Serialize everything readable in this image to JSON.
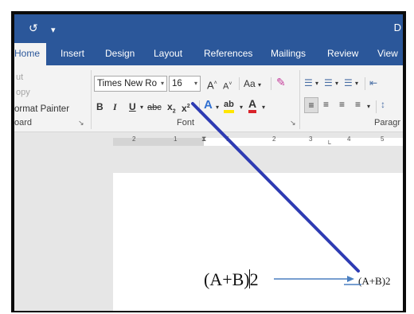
{
  "quick_access": {
    "undo_icon": "undo-icon",
    "customize_icon": "customize-icon"
  },
  "title_bar": {
    "doc_letter": "D"
  },
  "tabs": [
    "Home",
    "Insert",
    "Design",
    "Layout",
    "References",
    "Mailings",
    "Review",
    "View"
  ],
  "active_tab": "Home",
  "clipboard": {
    "cut": "ut",
    "copy": "opy",
    "format_painter": "ormat Painter",
    "group_label": "oard",
    "launcher_icon": "dialog-launcher-icon"
  },
  "font": {
    "font_name": "Times New Ro",
    "font_size": "16",
    "grow_label": "A",
    "shrink_label": "A",
    "change_case_label": "Aa",
    "clear_format_icon": "eraser-icon",
    "bold": "B",
    "italic": "I",
    "underline": "U",
    "strikethrough": "abc",
    "subscript": "x",
    "superscript": "x",
    "text_effects": "A",
    "highlight": "ab",
    "font_color": "A",
    "group_label": "Font",
    "launcher_icon": "dialog-launcher-icon"
  },
  "paragraph": {
    "group_label": "Paragr"
  },
  "ruler": {
    "labels": [
      "2",
      "1",
      "1",
      "2",
      "3",
      "4",
      "5"
    ]
  },
  "document": {
    "formula_typed": "(A+B)2",
    "formula_result": "(A+B)2"
  },
  "colors": {
    "word_blue": "#2b579a",
    "annotation_line": "#2e3bb3",
    "arrow": "#4a7fc1",
    "highlight_yellow": "#ffe600",
    "font_red": "#d9232a"
  }
}
